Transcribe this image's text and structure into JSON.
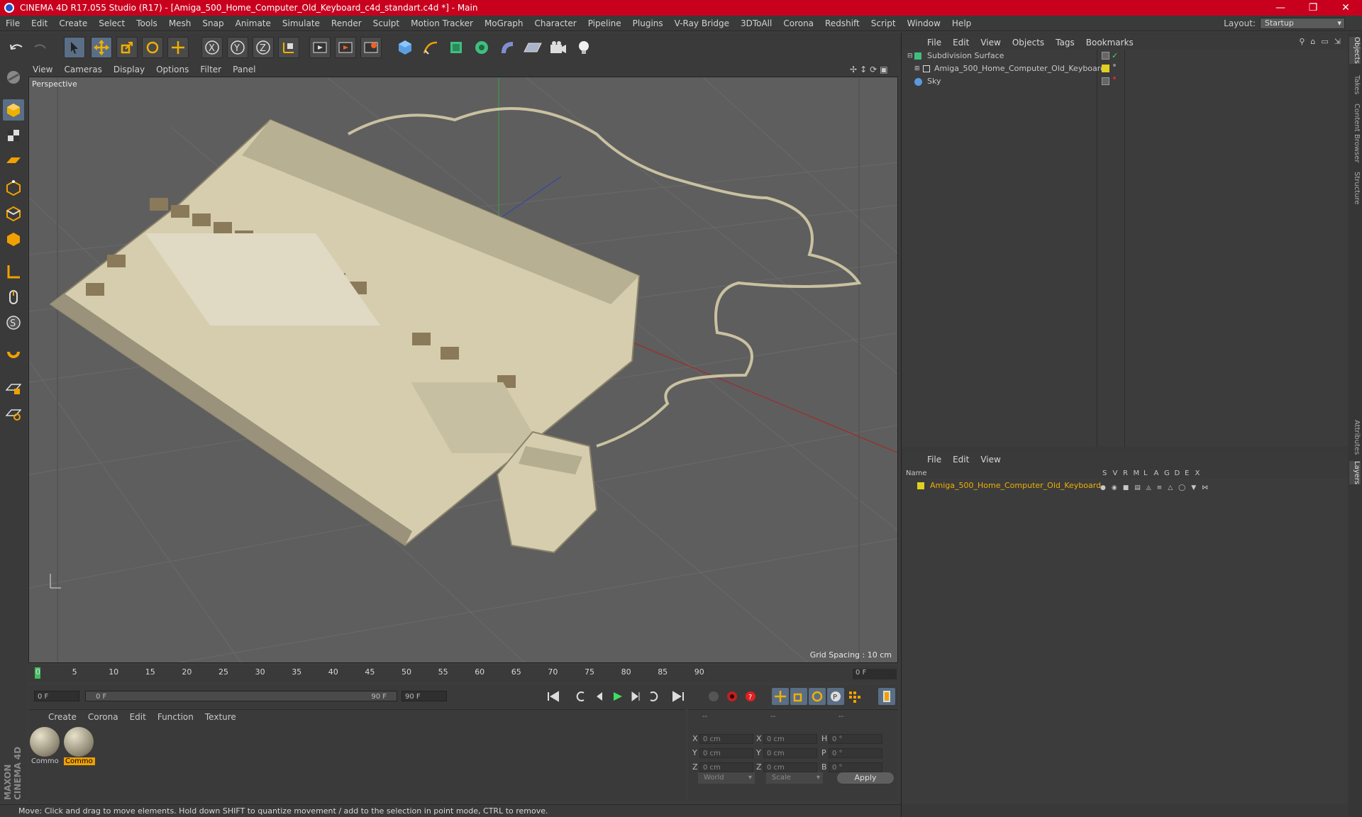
{
  "window": {
    "title": "CINEMA 4D R17.055 Studio (R17) - [Amiga_500_Home_Computer_Old_Keyboard_c4d_standart.c4d *] - Main"
  },
  "menubar": {
    "items": [
      "File",
      "Edit",
      "Create",
      "Select",
      "Tools",
      "Mesh",
      "Snap",
      "Animate",
      "Simulate",
      "Render",
      "Sculpt",
      "Motion Tracker",
      "MoGraph",
      "Character",
      "Pipeline",
      "Plugins",
      "V-Ray Bridge",
      "3DToAll",
      "Corona",
      "Redshift",
      "Script",
      "Window",
      "Help"
    ],
    "layout_label": "Layout:",
    "layout_value": "Startup"
  },
  "viewport": {
    "menu": [
      "View",
      "Cameras",
      "Display",
      "Options",
      "Filter",
      "Panel"
    ],
    "camera_label": "Perspective",
    "grid_spacing": "Grid Spacing : 10 cm"
  },
  "timeline": {
    "ticks": [
      "0",
      "5",
      "10",
      "15",
      "20",
      "25",
      "30",
      "35",
      "40",
      "45",
      "50",
      "55",
      "60",
      "65",
      "70",
      "75",
      "80",
      "85",
      "90"
    ],
    "current_frame": "0 F"
  },
  "transport": {
    "start": "0 F",
    "range_start": "0 F",
    "range_end": "90 F",
    "end": "90 F"
  },
  "materials": {
    "menu": [
      "Create",
      "Corona",
      "Edit",
      "Function",
      "Texture"
    ],
    "items": [
      {
        "label": "Commo"
      },
      {
        "label": "Commo"
      }
    ]
  },
  "coords": {
    "header": [
      "--",
      "--",
      "--"
    ],
    "rows": [
      {
        "a": "X",
        "v1": "0 cm",
        "b": "X",
        "v2": "0 cm",
        "c": "H",
        "v3": "0 °"
      },
      {
        "a": "Y",
        "v1": "0 cm",
        "b": "Y",
        "v2": "0 cm",
        "c": "P",
        "v3": "0 °"
      },
      {
        "a": "Z",
        "v1": "0 cm",
        "b": "Z",
        "v2": "0 cm",
        "c": "B",
        "v3": "0 °"
      }
    ],
    "mode1": "World",
    "mode2": "Scale",
    "apply": "Apply"
  },
  "status": "Move: Click and drag to move elements. Hold down SHIFT to quantize movement / add to the selection in point mode, CTRL to remove.",
  "objects": {
    "menu": [
      "File",
      "Edit",
      "View",
      "Objects",
      "Tags",
      "Bookmarks"
    ],
    "rows": [
      {
        "name": "Subdivision Surface"
      },
      {
        "name": "Amiga_500_Home_Computer_Old_Keyboard"
      },
      {
        "name": "Sky"
      }
    ]
  },
  "layers": {
    "menu": [
      "File",
      "Edit",
      "View"
    ],
    "name_header": "Name",
    "flags": [
      "S",
      "V",
      "R",
      "M",
      "L",
      "A",
      "G",
      "D",
      "E",
      "X"
    ],
    "rows": [
      {
        "name": "Amiga_500_Home_Computer_Old_Keyboard"
      }
    ]
  },
  "sidetabs": [
    "Objects",
    "Takes",
    "Content Browser",
    "Structure",
    "Attributes",
    "Layers"
  ],
  "brand": "MAXON CINEMA 4D",
  "colors": {
    "title_bar": "#c8001e",
    "accent": "#f0a000",
    "viewport": "#5e5e5e",
    "panel": "#3a3a3a"
  }
}
